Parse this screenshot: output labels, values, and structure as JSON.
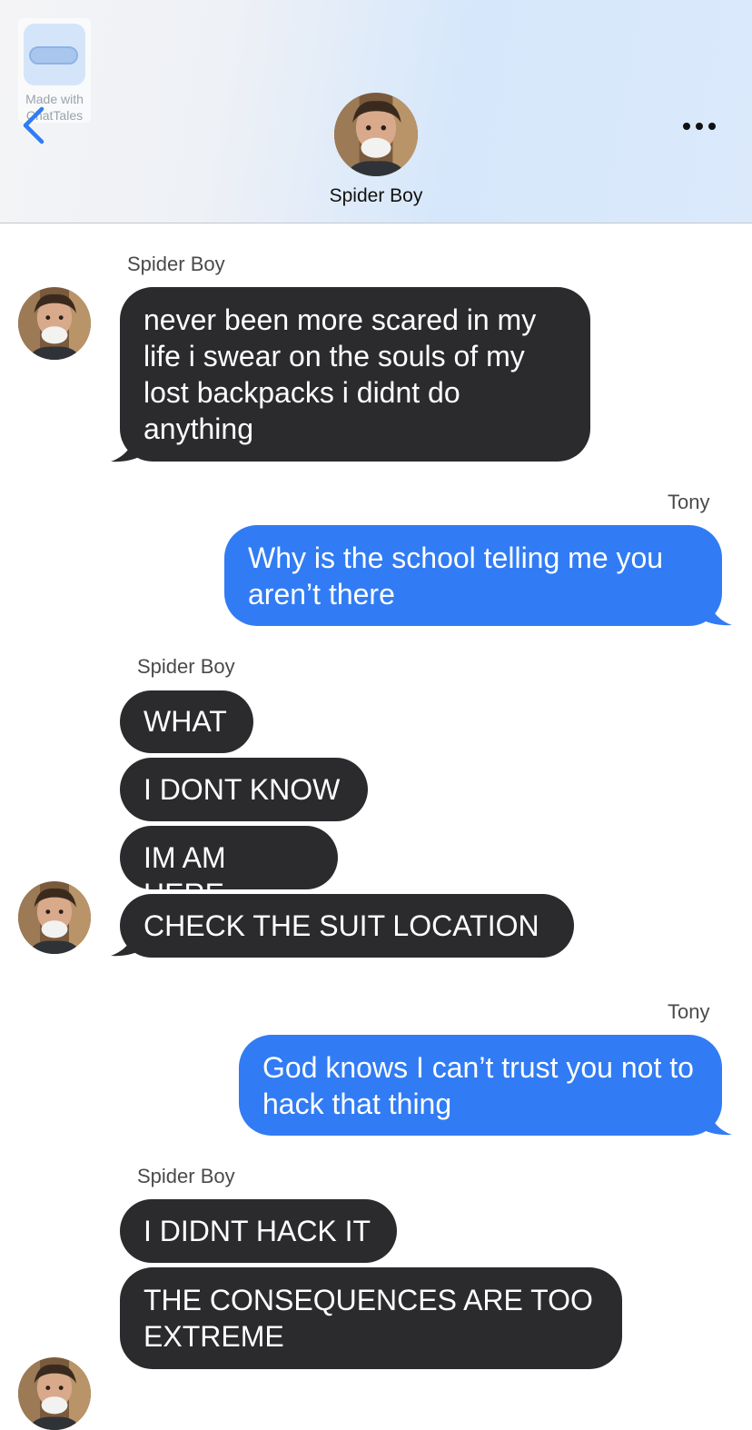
{
  "watermark": {
    "line1": "Made with",
    "line2": "ChatTales"
  },
  "header": {
    "contact_name": "Spider Boy",
    "back_icon": "chevron-left-icon",
    "more_icon": "ellipsis-icon"
  },
  "colors": {
    "incoming": "#2b2b2e",
    "outgoing": "#317cf4",
    "accent": "#2f7cf6"
  },
  "messages": [
    {
      "sender": "Spider Boy",
      "text": "never been more scared in my life i swear on the souls of my lost backpacks i didnt do anything"
    },
    {
      "sender": "Tony",
      "text": "Why is the school telling me you aren’t there"
    },
    {
      "sender": "Spider Boy",
      "texts": [
        "WHAT",
        "I DONT KNOW",
        "IM AM HERE",
        "CHECK THE SUIT LOCATION"
      ]
    },
    {
      "sender": "Tony",
      "text": "God knows I can’t trust you not to hack that thing"
    },
    {
      "sender": "Spider Boy",
      "texts": [
        "I DIDNT HACK IT",
        "THE CONSEQUENCES ARE TOO EXTREME"
      ]
    }
  ]
}
